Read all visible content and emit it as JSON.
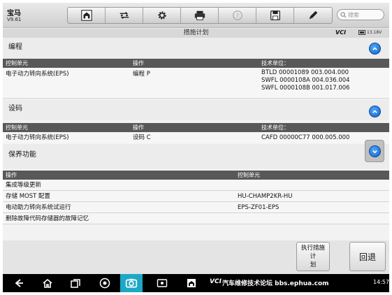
{
  "app": {
    "brand": "宝马",
    "version": "V9.61"
  },
  "toolbar": {
    "items": [
      {
        "icon": "home-icon"
      },
      {
        "icon": "vehicle-swap-icon"
      },
      {
        "icon": "gear-icon"
      },
      {
        "icon": "print-icon"
      },
      {
        "icon": "help-icon"
      },
      {
        "icon": "save-icon"
      },
      {
        "icon": "pen-icon"
      }
    ],
    "search_placeholder": "搜索"
  },
  "titlebar": {
    "title": "措施计划",
    "vci": "VCI",
    "voltage": "13.18V"
  },
  "sections": {
    "programming": {
      "title": "编程",
      "headers": [
        "控制单元",
        "操作",
        "技术单位："
      ],
      "row": {
        "unit": "电子动力转向系统(EPS)",
        "operation": "编程 P",
        "tech_units": [
          "BTLD 00001089 003.004.000",
          "SWFL 0000108A 004.036.004",
          "SWFL 0000108B 001.017.006"
        ]
      }
    },
    "coding": {
      "title": "设码",
      "headers": [
        "控制单元",
        "操作",
        "技术单位："
      ],
      "row": {
        "unit": "电子动力转向系统(EPS)",
        "operation": "设码 C",
        "tech_units": [
          "CAFD 00000C77 000.005.000"
        ]
      }
    },
    "maintenance": {
      "title": "保养功能",
      "headers": [
        "操作",
        "控制单元"
      ],
      "rows": [
        {
          "operation": "集成等级更新",
          "unit": ""
        },
        {
          "operation": "存储 MOST 配置",
          "unit": "HU-CHAMP2KR-HU"
        },
        {
          "operation": "电动助力转向系统试运行",
          "unit": "EPS-ZF01-EPS"
        },
        {
          "operation": "删除故障代码存储器的故障记忆",
          "unit": ""
        }
      ]
    }
  },
  "footer": {
    "run_label_line1": "执行措施计",
    "run_label_line2": "划",
    "back_label": "回退"
  },
  "navbar": {
    "watermark": "汽车维修技术论坛 bbs.ephua.com",
    "vci_short": "VCI",
    "time": "14:57"
  },
  "colors": {
    "accent": "#1565c0",
    "header_row": "#585858",
    "nav_bg": "#000000",
    "camera": "#1da8c6"
  }
}
